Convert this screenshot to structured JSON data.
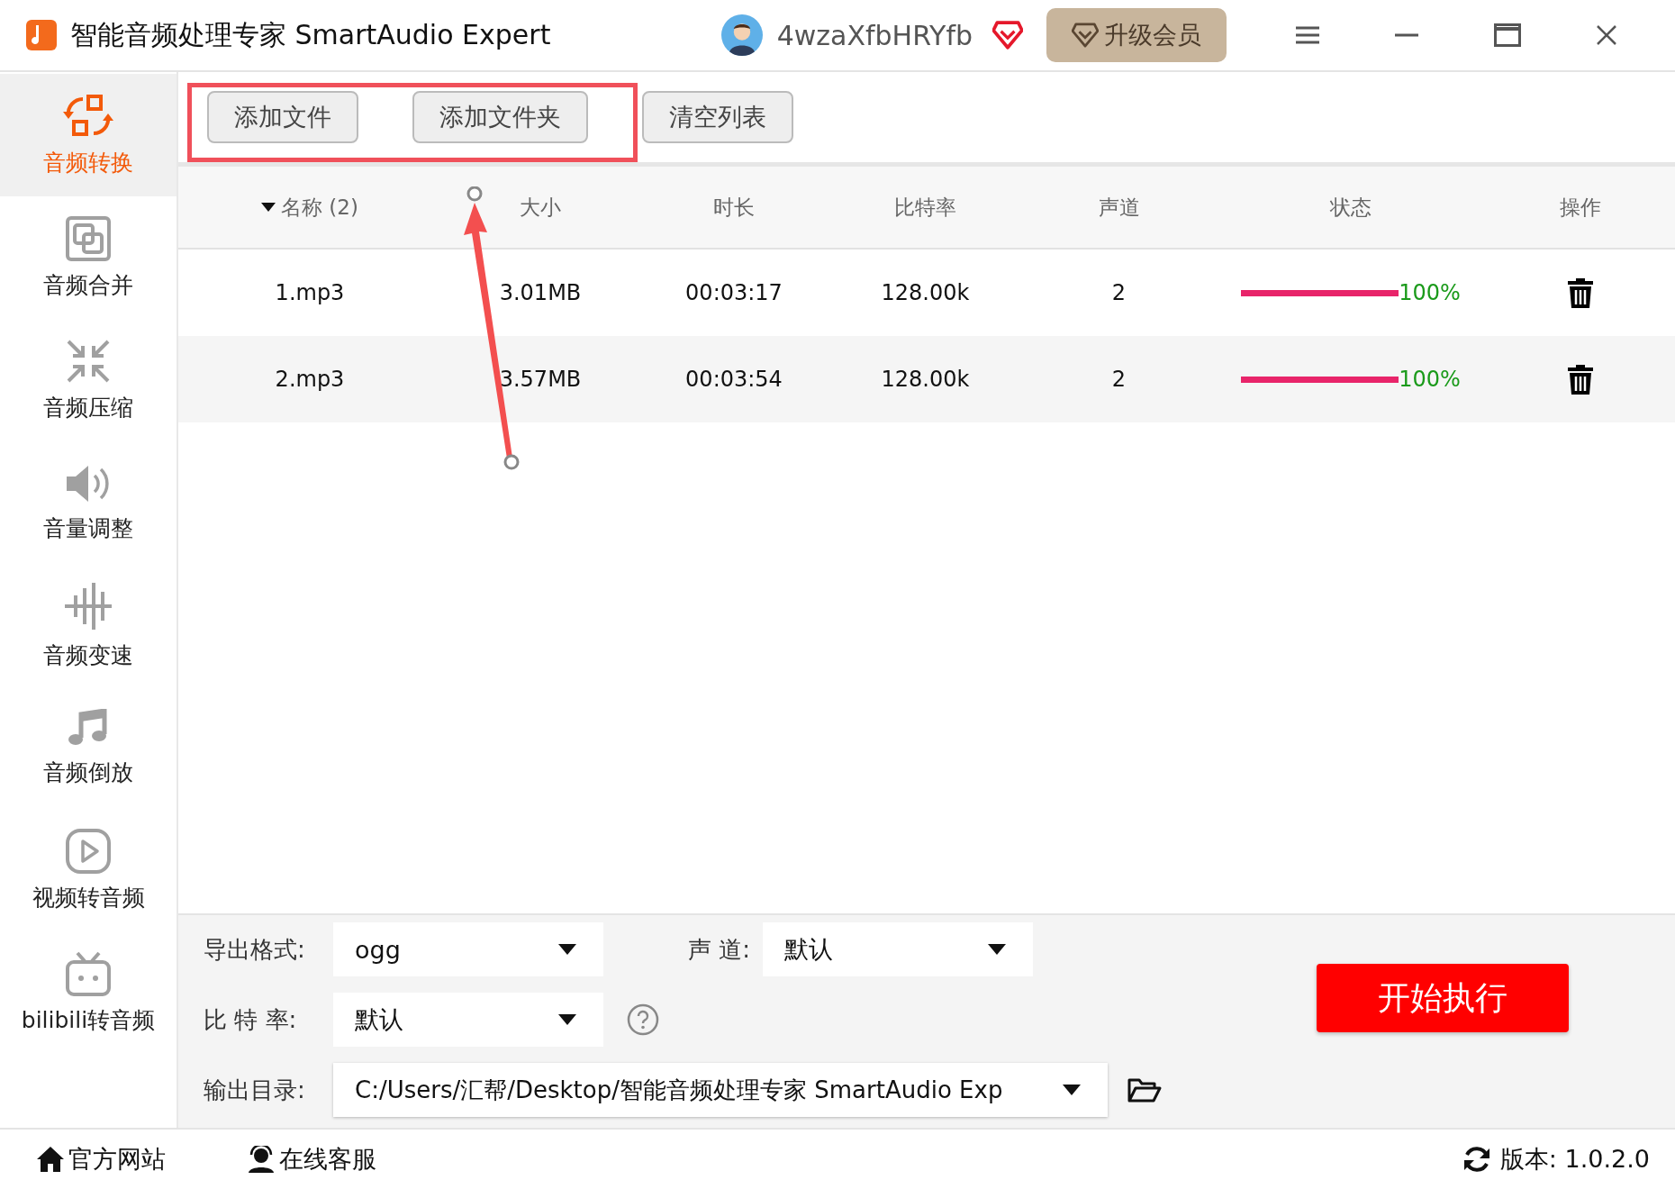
{
  "window": {
    "title": "智能音频处理专家 SmartAudio Expert",
    "username": "4wzaXfbHRYfb",
    "upgrade_button": "升级会员"
  },
  "sidebar": {
    "items": [
      {
        "label": "音频转换",
        "kind": "convert",
        "selected": true
      },
      {
        "label": "音频合并",
        "kind": "merge",
        "selected": false
      },
      {
        "label": "音频压缩",
        "kind": "compress",
        "selected": false
      },
      {
        "label": "音量调整",
        "kind": "volume",
        "selected": false
      },
      {
        "label": "音频变速",
        "kind": "speed",
        "selected": false
      },
      {
        "label": "音频倒放",
        "kind": "music",
        "selected": false
      },
      {
        "label": "视频转音频",
        "kind": "video",
        "selected": false
      },
      {
        "label": "bilibili转音频",
        "kind": "tv",
        "selected": false
      }
    ]
  },
  "toolbar": {
    "buttons": [
      "添加文件",
      "添加文件夹",
      "清空列表"
    ]
  },
  "table": {
    "columns": [
      "名称 (2)",
      "大小",
      "时长",
      "比特率",
      "声道",
      "状态",
      "操作"
    ],
    "rows": [
      {
        "name": "1.mp3",
        "size": "3.01MB",
        "duration": "00:03:17",
        "bitrate": "128.00k",
        "channels": "2",
        "level": 1,
        "status": "100%"
      },
      {
        "name": "2.mp3",
        "size": "3.57MB",
        "duration": "00:03:54",
        "bitrate": "128.00k",
        "channels": "2",
        "level": 1,
        "status": "100%"
      }
    ]
  },
  "settings": {
    "format_label": "导出格式:",
    "format": "ogg",
    "channel_label": "声 道:",
    "channel": "默认",
    "bitrate_label": "比 特 率:",
    "bitrate": "默认",
    "output_label": "输出目录:",
    "output_dir": "C:/Users/汇帮/Desktop/智能音频处理专家 SmartAudio Exp",
    "start_button": "开始执行"
  },
  "status_bar": {
    "links": [
      {
        "label": "官方网站",
        "kind": "home"
      },
      {
        "label": "在线客服",
        "kind": "support"
      }
    ],
    "version": "版本:  1.0.2.0"
  }
}
